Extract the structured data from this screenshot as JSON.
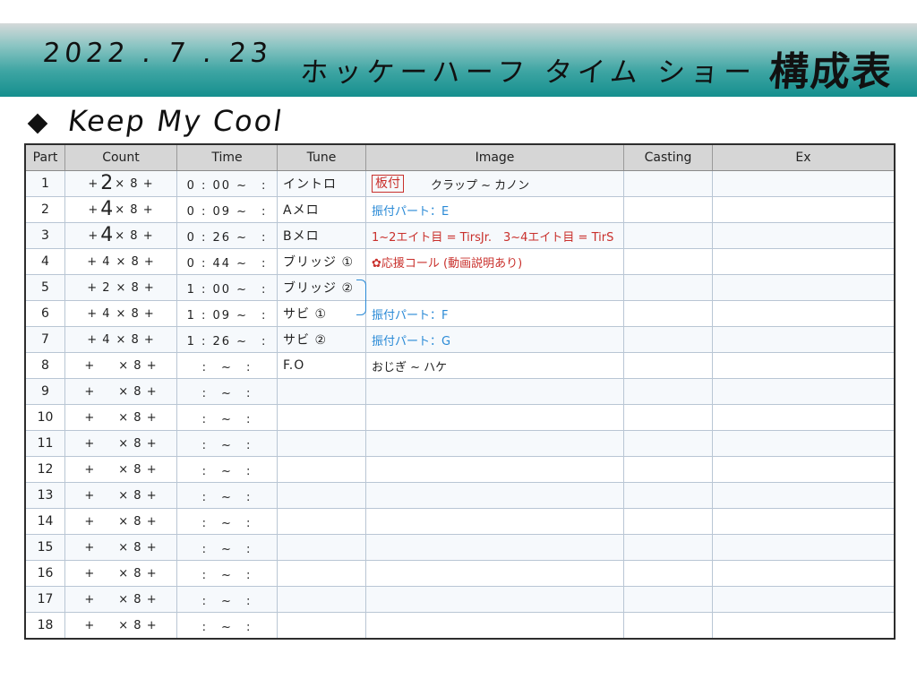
{
  "banner": {
    "date": "2022 . 7 . 23",
    "title": "ホッケーハーフ タイム ショー",
    "title_strong": "構成表"
  },
  "song": {
    "title": "Keep My Cool"
  },
  "table": {
    "headers": [
      "Part",
      "Count",
      "Time",
      "Tune",
      "Image",
      "Casting",
      "Ex"
    ],
    "rows": [
      {
        "part": "1",
        "count_pre": "+",
        "count_hand": "2",
        "count_post": "× 8 +",
        "time": "0 : 00 ~　:",
        "tune": "イントロ",
        "image_stamp": "板付",
        "image_black": "クラップ ~ カノン",
        "image_blue": "",
        "image_red": ""
      },
      {
        "part": "2",
        "count_pre": "+",
        "count_hand": "4",
        "count_post": "× 8 +",
        "time": "0 : 09 ~　:",
        "tune": "Aメロ",
        "image_stamp": "",
        "image_black": "",
        "image_blue": "振付パート：E",
        "image_red": ""
      },
      {
        "part": "3",
        "count_pre": "+",
        "count_hand": "4",
        "count_post": "× 8 +",
        "time": "0 : 26 ~　:",
        "tune": "Bメロ",
        "image_stamp": "",
        "image_black": "",
        "image_blue": "",
        "image_red": "1~2エイト目 = TirsJr.　3~4エイト目 = TirS"
      },
      {
        "part": "4",
        "count_pre": "+ 4",
        "count_hand": "",
        "count_post": "× 8 +",
        "time": "0 : 44 ~　:",
        "tune": "ブリッジ ①",
        "image_stamp": "",
        "image_black": "",
        "image_blue": "",
        "image_red": "✿応援コール (動画説明あり)"
      },
      {
        "part": "5",
        "count_pre": "+ 2",
        "count_hand": "",
        "count_post": "× 8 +",
        "time": "1 : 00 ~　:",
        "tune": "ブリッジ ②",
        "image_stamp": "",
        "image_black": "",
        "image_blue": "",
        "image_red": ""
      },
      {
        "part": "6",
        "count_pre": "+ 4",
        "count_hand": "",
        "count_post": "× 8 +",
        "time": "1 : 09 ~　:",
        "tune": "サビ ①",
        "image_stamp": "",
        "image_black": "",
        "image_blue": "振付パート：F",
        "image_red": ""
      },
      {
        "part": "7",
        "count_pre": "+ 4",
        "count_hand": "",
        "count_post": "× 8 +",
        "time": "1 : 26 ~　:",
        "tune": "サビ ②",
        "image_stamp": "",
        "image_black": "",
        "image_blue": "振付パート：G",
        "image_red": ""
      },
      {
        "part": "8",
        "count_pre": "+",
        "count_hand": "",
        "count_post": "× 8 +",
        "time": ":　~　:",
        "tune": "F.O",
        "image_stamp": "",
        "image_black": "おじぎ ~ ハケ",
        "image_blue": "",
        "image_red": ""
      },
      {
        "part": "9",
        "count_pre": "+",
        "count_hand": "",
        "count_post": "× 8 +",
        "time": ":　~　:",
        "tune": "",
        "image_stamp": "",
        "image_black": "",
        "image_blue": "",
        "image_red": ""
      },
      {
        "part": "10",
        "count_pre": "+",
        "count_hand": "",
        "count_post": "× 8 +",
        "time": ":　~　:",
        "tune": "",
        "image_stamp": "",
        "image_black": "",
        "image_blue": "",
        "image_red": ""
      },
      {
        "part": "11",
        "count_pre": "+",
        "count_hand": "",
        "count_post": "× 8 +",
        "time": ":　~　:",
        "tune": "",
        "image_stamp": "",
        "image_black": "",
        "image_blue": "",
        "image_red": ""
      },
      {
        "part": "12",
        "count_pre": "+",
        "count_hand": "",
        "count_post": "× 8 +",
        "time": ":　~　:",
        "tune": "",
        "image_stamp": "",
        "image_black": "",
        "image_blue": "",
        "image_red": ""
      },
      {
        "part": "13",
        "count_pre": "+",
        "count_hand": "",
        "count_post": "× 8 +",
        "time": ":　~　:",
        "tune": "",
        "image_stamp": "",
        "image_black": "",
        "image_blue": "",
        "image_red": ""
      },
      {
        "part": "14",
        "count_pre": "+",
        "count_hand": "",
        "count_post": "× 8 +",
        "time": ":　~　:",
        "tune": "",
        "image_stamp": "",
        "image_black": "",
        "image_blue": "",
        "image_red": ""
      },
      {
        "part": "15",
        "count_pre": "+",
        "count_hand": "",
        "count_post": "× 8 +",
        "time": ":　~　:",
        "tune": "",
        "image_stamp": "",
        "image_black": "",
        "image_blue": "",
        "image_red": ""
      },
      {
        "part": "16",
        "count_pre": "+",
        "count_hand": "",
        "count_post": "× 8 +",
        "time": ":　~　:",
        "tune": "",
        "image_stamp": "",
        "image_black": "",
        "image_blue": "",
        "image_red": ""
      },
      {
        "part": "17",
        "count_pre": "+",
        "count_hand": "",
        "count_post": "× 8 +",
        "time": ":　~　:",
        "tune": "",
        "image_stamp": "",
        "image_black": "",
        "image_blue": "",
        "image_red": ""
      },
      {
        "part": "18",
        "count_pre": "+",
        "count_hand": "",
        "count_post": "× 8 +",
        "time": ":　~　:",
        "tune": "",
        "image_stamp": "",
        "image_black": "",
        "image_blue": "",
        "image_red": ""
      }
    ]
  },
  "colors": {
    "banner_teal": "#158f8e",
    "annotation_blue": "#2a8ad6",
    "annotation_red": "#c9302c"
  }
}
